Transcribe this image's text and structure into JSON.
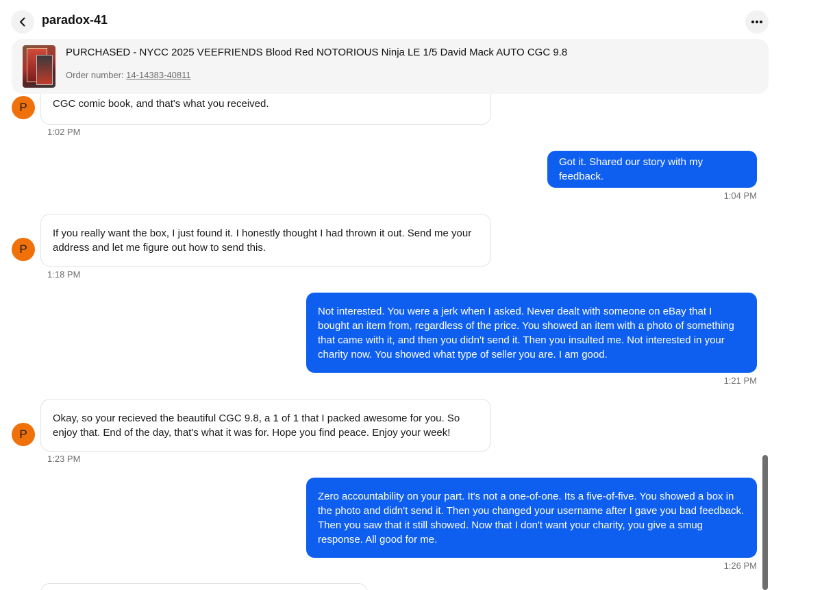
{
  "header": {
    "username": "paradox-41",
    "back_icon": "chevron-left-icon",
    "more_icon": "more-horizontal-icon"
  },
  "order": {
    "title": "PURCHASED - NYCC 2025 VEEFRIENDS Blood Red NOTORIOUS Ninja LE 1/5 David Mack AUTO CGC 9.8",
    "number_label": "Order number:",
    "number": "14-14383-40811"
  },
  "colors": {
    "accent_blue": "#0e5ff0",
    "avatar_orange": "#f0710a"
  },
  "messages": [
    {
      "direction": "in",
      "avatar": "P",
      "text": "CGC comic book, and that's what you received.",
      "time": "1:02 PM"
    },
    {
      "direction": "out",
      "text": "Got it. Shared our story with my feedback.",
      "time": "1:04 PM"
    },
    {
      "direction": "in",
      "avatar": "P",
      "text": "If you really want the box, I just found it. I honestly thought I had thrown it out. Send me your address and let me figure out how to send this.",
      "time": "1:18 PM"
    },
    {
      "direction": "out",
      "text": "Not interested. You were a jerk when I asked. Never dealt with someone on eBay that I bought an item from, regardless of the price. You showed an item with a photo of something that came with it, and then you didn't send it. Then you insulted me. Not interested in your charity now. You showed what type of seller you are. I am good.",
      "time": "1:21 PM"
    },
    {
      "direction": "in",
      "avatar": "P",
      "text": "Okay, so your recieved the beautiful CGC 9.8, a 1 of 1 that I packed awesome for you. So enjoy that. End of the day, that's what it was for. Hope you find peace. Enjoy your week!",
      "time": "1:23 PM"
    },
    {
      "direction": "out",
      "text": "Zero accountability on your part. It's not a one-of-one. Its a five-of-five. You showed a box in the photo and didn't send it. Then you changed your username after I gave you bad feedback. Then you saw that it still showed. Now that I don't want your charity, you give a smug response. All good for me.",
      "time": "1:26 PM"
    }
  ]
}
